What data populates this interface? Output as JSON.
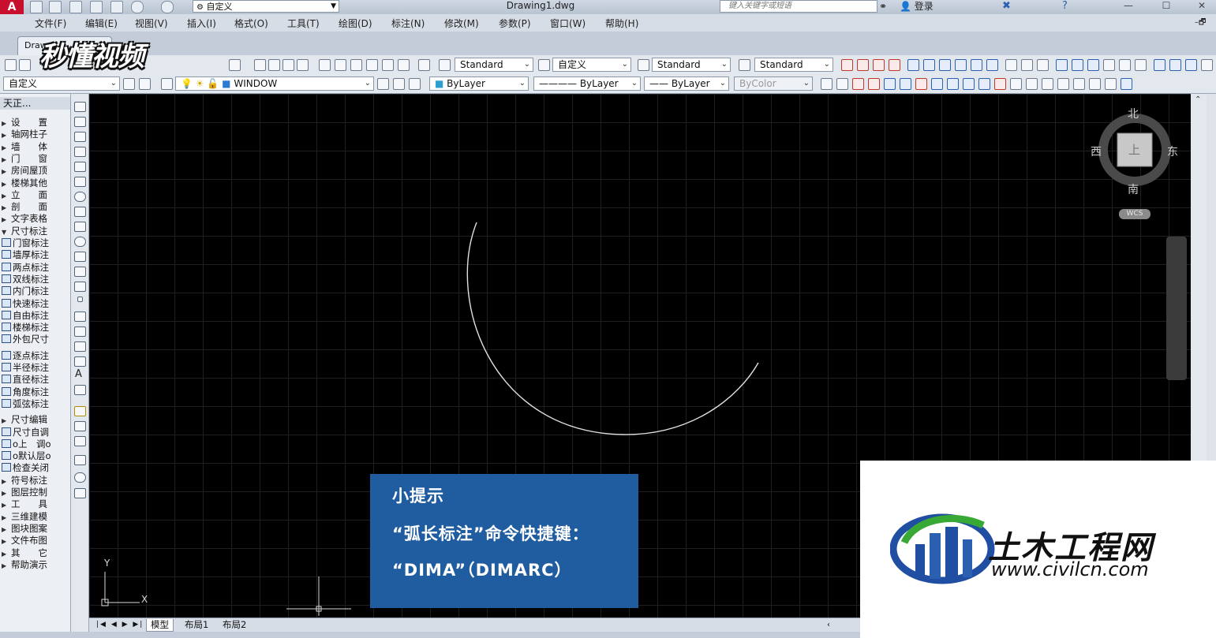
{
  "title_bar": {
    "app_letter": "A",
    "workspace": "自定义",
    "document_title": "Drawing1.dwg",
    "search_placeholder": "键入关键字或短语",
    "login_label": "登录"
  },
  "menu": [
    "文件(F)",
    "编辑(E)",
    "视图(V)",
    "插入(I)",
    "格式(O)",
    "工具(T)",
    "绘图(D)",
    "标注(N)",
    "修改(M)",
    "参数(P)",
    "窗口(W)",
    "帮助(H)"
  ],
  "doc_tab": "Draw",
  "toolbar1": {
    "text_style": "Standard",
    "dim_style": "自定义",
    "table_style": "Standard",
    "multileader_style": "Standard"
  },
  "toolbar2": {
    "workspace": "自定义",
    "layer": "WINDOW",
    "color": "ByLayer",
    "linetype": "ByLayer",
    "lineweight": "ByLayer",
    "plotstyle": "ByColor"
  },
  "left_panel": {
    "title": "天正...",
    "items": [
      {
        "label": "设　　置",
        "type": "section"
      },
      {
        "label": "轴网柱子",
        "type": "section"
      },
      {
        "label": "墙　　体",
        "type": "section"
      },
      {
        "label": "门　　窗",
        "type": "section"
      },
      {
        "label": "房间屋顶",
        "type": "section"
      },
      {
        "label": "楼梯其他",
        "type": "section"
      },
      {
        "label": "立　　面",
        "type": "section"
      },
      {
        "label": "剖　　面",
        "type": "section"
      },
      {
        "label": "文字表格",
        "type": "section"
      },
      {
        "label": "尺寸标注",
        "type": "open"
      },
      {
        "label": "门窗标注",
        "type": "cmd"
      },
      {
        "label": "墙厚标注",
        "type": "cmd"
      },
      {
        "label": "两点标注",
        "type": "cmd"
      },
      {
        "label": "双线标注",
        "type": "cmd"
      },
      {
        "label": "内门标注",
        "type": "cmd"
      },
      {
        "label": "快速标注",
        "type": "cmd"
      },
      {
        "label": "自由标注",
        "type": "cmd"
      },
      {
        "label": "楼梯标注",
        "type": "cmd"
      },
      {
        "label": "外包尺寸",
        "type": "cmd"
      },
      {
        "label": "逐点标注",
        "type": "cmd"
      },
      {
        "label": "半径标注",
        "type": "cmd"
      },
      {
        "label": "直径标注",
        "type": "cmd"
      },
      {
        "label": "角度标注",
        "type": "cmd"
      },
      {
        "label": "弧弦标注",
        "type": "cmd"
      },
      {
        "label": "尺寸编辑",
        "type": "section"
      },
      {
        "label": "尺寸自调",
        "type": "cmd"
      },
      {
        "label": "o上　调o",
        "type": "cmd"
      },
      {
        "label": "o默认层o",
        "type": "cmd"
      },
      {
        "label": "检查关闭",
        "type": "cmd"
      },
      {
        "label": "符号标注",
        "type": "section"
      },
      {
        "label": "图层控制",
        "type": "section"
      },
      {
        "label": "工　　具",
        "type": "section"
      },
      {
        "label": "三维建模",
        "type": "section"
      },
      {
        "label": "图块图案",
        "type": "section"
      },
      {
        "label": "文件布图",
        "type": "section"
      },
      {
        "label": "其　　它",
        "type": "section"
      },
      {
        "label": "帮助演示",
        "type": "section"
      }
    ]
  },
  "viewcube": {
    "north": "北",
    "south": "南",
    "west": "西",
    "east": "东",
    "face": "上",
    "wcs": "WCS"
  },
  "ucs": {
    "x": "X",
    "y": "Y"
  },
  "tip": {
    "title": "小提示",
    "line1": "“弧长标注”命令快捷键：",
    "line2": "“DIMA”（DIMARC）"
  },
  "layout_tabs": [
    "模型",
    "布局1",
    "布局2"
  ],
  "watermark": "秒懂视频",
  "logo": {
    "name": "土木工程网",
    "url": "www.civilcn.com"
  },
  "colors": {
    "canvas": "#000000",
    "tip_box": "#1f5ca0",
    "app_red": "#c8102e"
  }
}
